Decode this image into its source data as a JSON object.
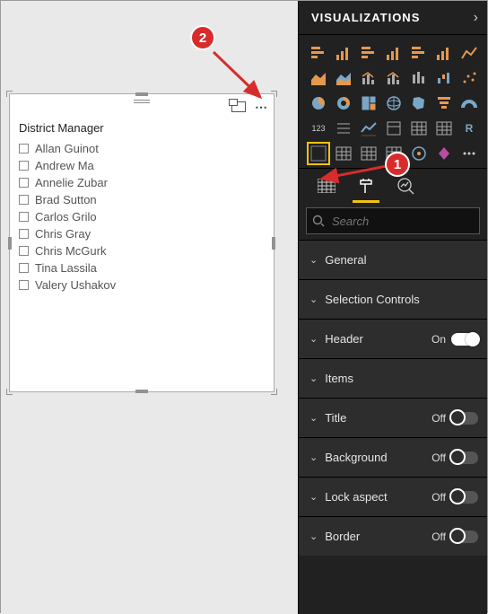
{
  "canvas": {
    "slicer": {
      "field_header": "District Manager",
      "items": [
        "Allan Guinot",
        "Andrew Ma",
        "Annelie Zubar",
        "Brad Sutton",
        "Carlos Grilo",
        "Chris Gray",
        "Chris McGurk",
        "Tina Lassila",
        "Valery Ushakov"
      ]
    }
  },
  "panel": {
    "title": "VISUALIZATIONS",
    "search_placeholder": "Search",
    "viz_icons": [
      "stacked-bar",
      "stacked-column",
      "clustered-bar",
      "clustered-column",
      "100-stacked-bar",
      "100-stacked-column",
      "line",
      "area",
      "stacked-area",
      "line-stacked-column",
      "line-clustered-column",
      "ribbon",
      "waterfall",
      "scatter",
      "pie",
      "donut",
      "treemap",
      "map",
      "filled-map",
      "funnel",
      "gauge",
      "card",
      "multi-row-card",
      "kpi",
      "slicer",
      "table",
      "matrix",
      "r-visual",
      "py-visual",
      "key-influencers",
      "decomposition-tree",
      "q-and-a",
      "arcgis",
      "powerapps",
      "more-visuals"
    ],
    "selected_viz_index": 28,
    "tabs": {
      "active": "format"
    },
    "format_sections": [
      {
        "label": "General",
        "toggle": null
      },
      {
        "label": "Selection Controls",
        "toggle": null
      },
      {
        "label": "Header",
        "toggle": "On"
      },
      {
        "label": "Items",
        "toggle": null
      },
      {
        "label": "Title",
        "toggle": "Off"
      },
      {
        "label": "Background",
        "toggle": "Off"
      },
      {
        "label": "Lock aspect",
        "toggle": "Off"
      },
      {
        "label": "Border",
        "toggle": "Off"
      }
    ]
  },
  "annotations": {
    "badge1": "1",
    "badge2": "2"
  }
}
